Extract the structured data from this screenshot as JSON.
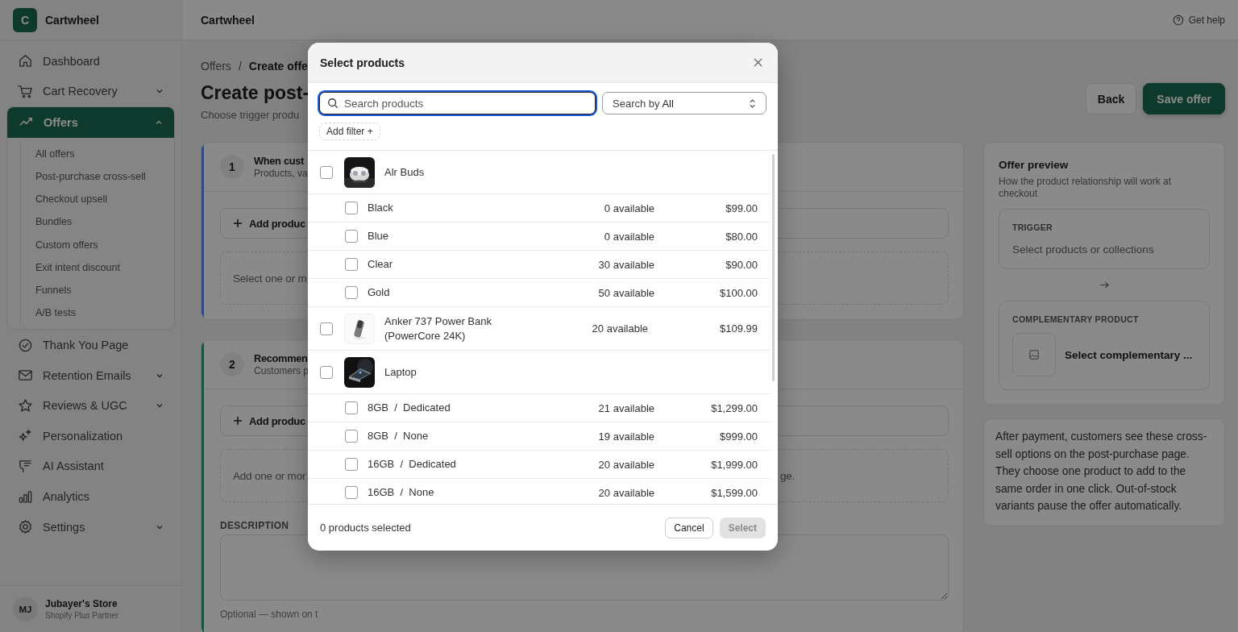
{
  "sidebar": {
    "brand": {
      "initial": "C",
      "name": "Cartwheel"
    },
    "items": [
      {
        "label": "Dashboard",
        "kind": "link",
        "selected": false
      },
      {
        "label": "Cart Recovery",
        "kind": "group",
        "selected": false,
        "expanded": false
      },
      {
        "label": "Offers",
        "kind": "group",
        "selected": true,
        "expanded": true,
        "children": [
          {
            "label": "All offers",
            "selected": false
          },
          {
            "label": "Post-purchase cross-sell",
            "selected": false
          },
          {
            "label": "Checkout upsell",
            "selected": false
          },
          {
            "label": "Bundles",
            "selected": false
          },
          {
            "label": "Custom offers",
            "selected": false
          },
          {
            "label": "Exit intent discount",
            "selected": false
          },
          {
            "label": "Funnels",
            "selected": false
          },
          {
            "label": "A/B tests",
            "selected": false
          }
        ]
      },
      {
        "label": "Thank You Page",
        "kind": "link",
        "selected": false
      },
      {
        "label": "Retention Emails",
        "kind": "group",
        "selected": false,
        "expanded": false
      },
      {
        "label": "Reviews & UGC",
        "kind": "group",
        "selected": false,
        "expanded": false
      },
      {
        "label": "Personalization",
        "kind": "link",
        "selected": false
      },
      {
        "label": "AI Assistant",
        "kind": "link",
        "selected": false
      },
      {
        "label": "Analytics",
        "kind": "link",
        "selected": false
      },
      {
        "label": "Settings",
        "kind": "group",
        "selected": false,
        "expanded": false
      }
    ],
    "user": {
      "initials": "MJ",
      "name": "Jubayer's Store",
      "subtitle": "Shopify Plus Partner"
    }
  },
  "topbar": {
    "title": "Cartwheel",
    "help": "Get help"
  },
  "page": {
    "breadcrumb": [
      "Offers",
      "/",
      "Create offe"
    ],
    "title": "Create post-",
    "subtitle": "Choose trigger produ",
    "buttons": [
      {
        "label": "Back",
        "kind": "secondary"
      },
      {
        "label": "Save offer",
        "kind": "primary"
      }
    ]
  },
  "steps": [
    {
      "number": "1",
      "title": "When cust",
      "subtitle": "Products, va",
      "add_button": "Add produc",
      "empty_text": "Select one or m",
      "color": "#2f4a86"
    },
    {
      "number": "2",
      "title": "Recommen",
      "subtitle": "Customers p",
      "add_button": "Add produc",
      "empty_text": "Add one or mor",
      "empty_text_end": "ge.",
      "color": "#1a5442",
      "description_label": "DESCRIPTION",
      "description_help": "Optional — shown on t"
    }
  ],
  "preview": {
    "title": "Offer preview",
    "subtitle": "How the product relationship will work at checkout",
    "trigger_label": "TRIGGER",
    "trigger_text": "Select products or collections",
    "product_label": "COMPLEMENTARY PRODUCT",
    "product_text": "Select complementary ...",
    "note": "After payment, customers see these cross-sell options on the post-purchase page. They choose one product to add to the same order in one click. Out-of-stock variants pause the offer automatically."
  },
  "modal": {
    "title": "Select products",
    "search": {
      "placeholder": "Search products",
      "focused": true
    },
    "search_by": {
      "label": "Search by",
      "value": "All"
    },
    "add_filter": "Add filter +",
    "rows": [
      {
        "kind": "product",
        "name": "Alr Buds",
        "checked": false
      },
      {
        "kind": "variant",
        "name": "Black",
        "available": "0 available",
        "price": "$99.00",
        "checked": false
      },
      {
        "kind": "variant",
        "name": "Blue",
        "available": "0 available",
        "price": "$80.00",
        "checked": false
      },
      {
        "kind": "variant",
        "name": "Clear",
        "available": "30 available",
        "price": "$90.00",
        "checked": false
      },
      {
        "kind": "variant",
        "name": "Gold",
        "available": "50 available",
        "price": "$100.00",
        "checked": false
      },
      {
        "kind": "product",
        "name": "Anker 737 Power Bank (PowerCore 24K)",
        "available": "20 available",
        "price": "$109.99",
        "checked": false
      },
      {
        "kind": "product",
        "name": "Laptop",
        "checked": false
      },
      {
        "kind": "variant",
        "name": "8GB  /  Dedicated",
        "available": "21 available",
        "price": "$1,299.00",
        "checked": false
      },
      {
        "kind": "variant",
        "name": "8GB  /  None",
        "available": "19 available",
        "price": "$999.00",
        "checked": false
      },
      {
        "kind": "variant",
        "name": "16GB  /  Dedicated",
        "available": "20 available",
        "price": "$1,999.00",
        "checked": false
      },
      {
        "kind": "variant",
        "name": "16GB  /  None",
        "available": "20 available",
        "price": "$1,599.00",
        "checked": false
      }
    ],
    "footer": {
      "count": "0 products selected",
      "cancel": "Cancel",
      "select": {
        "label": "Select",
        "disabled": true
      }
    }
  }
}
